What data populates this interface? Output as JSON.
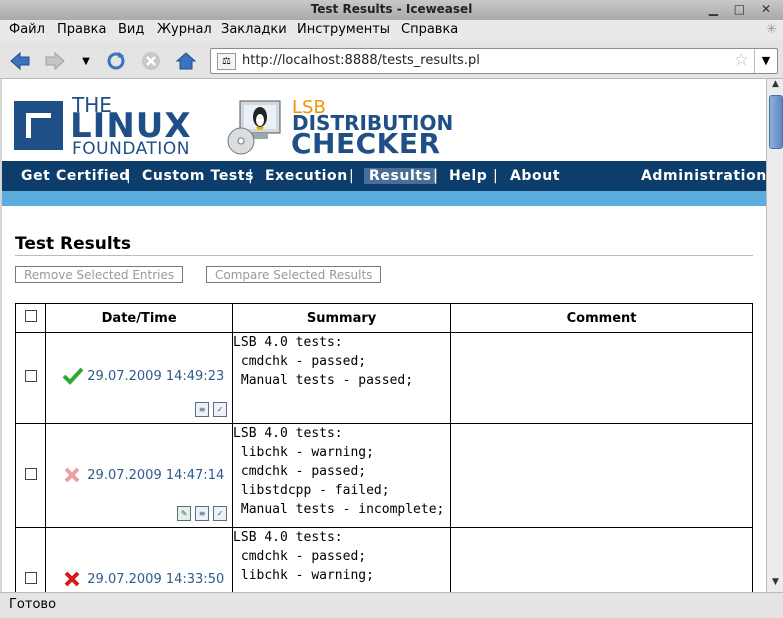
{
  "window": {
    "title": "Test Results - Iceweasel"
  },
  "menu": [
    "Файл",
    "Правка",
    "Вид",
    "Журнал",
    "Закладки",
    "Инструменты",
    "Справка"
  ],
  "urlbar": {
    "url": "http://localhost:8888/tests_results.pl"
  },
  "status": "Готово",
  "logo": {
    "lf_the": "THE",
    "lf_linux": "LINUX",
    "lf_foundation": "FOUNDATION",
    "lsb": "LSB",
    "distribution": "DISTRIBUTION",
    "checker": "CHECKER"
  },
  "nav": {
    "items": [
      "Get Certified",
      "Custom Tests",
      "Execution",
      "Results",
      "Help",
      "About"
    ],
    "admin": "Administration",
    "active": "Results"
  },
  "page": {
    "title": "Test Results",
    "remove_btn": "Remove Selected Entries",
    "compare_btn": "Compare Selected Results"
  },
  "table": {
    "headers": [
      "Date/Time",
      "Summary",
      "Comment"
    ],
    "rows": [
      {
        "date": "29.07.2009 14:49:23",
        "status": "passed",
        "summary": "LSB 4.0 tests:\n cmdchk - passed;\n Manual tests - passed;",
        "comment": ""
      },
      {
        "date": "29.07.2009 14:47:14",
        "status": "warning",
        "summary": "LSB 4.0 tests:\n libchk - warning;\n cmdchk - passed;\n libstdcpp - failed;\n Manual tests - incomplete;",
        "comment": ""
      },
      {
        "date": "29.07.2009 14:33:50",
        "status": "failed",
        "summary": "LSB 4.0 tests:\n cmdchk - passed;\n libchk - warning;",
        "comment": ""
      }
    ]
  },
  "colors": {
    "nav_bg": "#0d3d6b",
    "subbar": "#5badde",
    "link": "#2e5b8c",
    "lsb_orange": "#f29400"
  }
}
